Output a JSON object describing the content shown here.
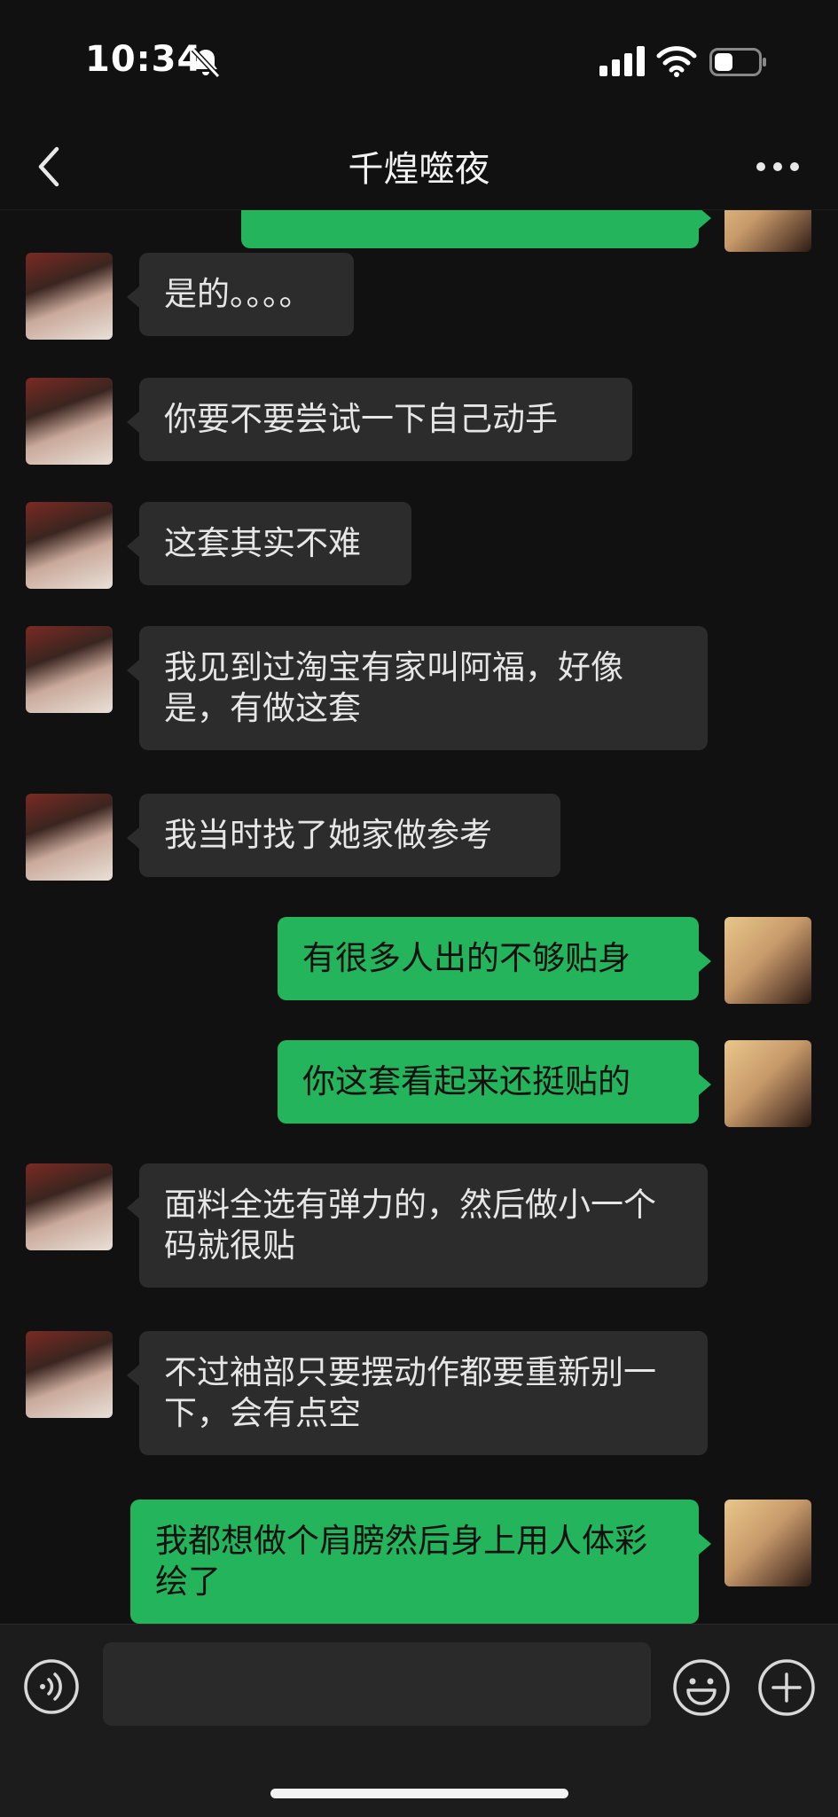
{
  "status_bar": {
    "time": "10:34",
    "icons": [
      "bell-off-icon",
      "signal-icon",
      "wifi-icon",
      "battery-icon"
    ]
  },
  "header": {
    "title": "千煌噬夜",
    "back_icon": "chevron-left-icon",
    "more_icon": "more-dots-icon"
  },
  "messages": [
    {
      "from": "them",
      "text": "是的。。。。"
    },
    {
      "from": "them",
      "text": "你要不要尝试一下自己动手"
    },
    {
      "from": "them",
      "text": "这套其实不难"
    },
    {
      "from": "them",
      "text": "我见到过淘宝有家叫阿福，好像是，有做这套"
    },
    {
      "from": "them",
      "text": "我当时找了她家做参考"
    },
    {
      "from": "me",
      "text": "有很多人出的不够贴身"
    },
    {
      "from": "me",
      "text": "你这套看起来还挺贴的"
    },
    {
      "from": "them",
      "text": "面料全选有弹力的，然后做小一个码就很贴"
    },
    {
      "from": "them",
      "text": "不过袖部只要摆动作都要重新别一下，会有点空"
    },
    {
      "from": "me",
      "text": "我都想做个肩膀然后身上用人体彩绘了"
    }
  ],
  "input_bar": {
    "value": "",
    "icons": [
      "voice-icon",
      "emoji-icon",
      "plus-icon"
    ]
  },
  "colors": {
    "background": "#111111",
    "incoming_bubble": "#2c2c2c",
    "outgoing_bubble": "#23b45c"
  }
}
